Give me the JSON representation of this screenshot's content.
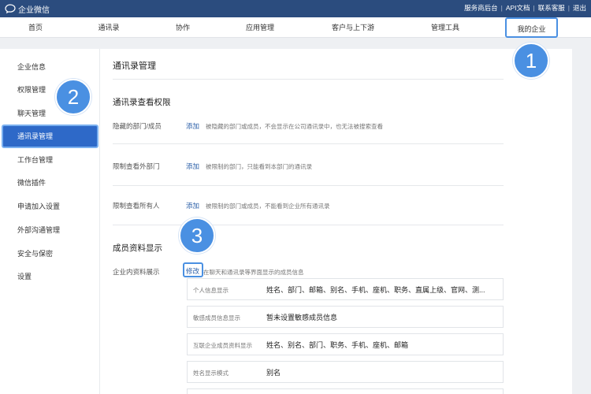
{
  "app": {
    "name": "企业微信"
  },
  "top_links": [
    "服务商后台",
    "API文档",
    "联系客服",
    "退出"
  ],
  "nav": {
    "items": [
      "首页",
      "通讯录",
      "协作",
      "应用管理",
      "客户与上下游",
      "管理工具"
    ],
    "active": "我的企业"
  },
  "sidebar": {
    "items": [
      "企业信息",
      "权限管理",
      "聊天管理",
      "工作台管理",
      "微信插件",
      "申请加入设置",
      "外部沟通管理",
      "安全与保密",
      "设置"
    ],
    "active": "通讯录管理"
  },
  "main": {
    "title": "通讯录管理",
    "section1_title": "通讯录查看权限",
    "rows": [
      {
        "label": "隐藏的部门/成员",
        "link": "添加",
        "desc": "被隐藏的部门或成员，不会显示在公司通讯录中，也无法被搜索查看"
      },
      {
        "label": "限制查看外部门",
        "link": "添加",
        "desc": "被限制的部门，只能看到本部门的通讯录"
      },
      {
        "label": "限制查看所有人",
        "link": "添加",
        "desc": "被限制的部门或成员，不能看到企业所有通讯录"
      }
    ],
    "section2_title": "成员资料显示",
    "profile_label": "企业内资料展示",
    "modify_link": "修改",
    "profile_desc": "在聊天和通讯录等界面显示的成员信息",
    "info_rows": [
      {
        "key": "个人信息显示",
        "value": "姓名、部门、邮箱、别名、手机、座机、职务、直属上级、官网、测..."
      },
      {
        "key": "敏感成员信息显示",
        "value": "暂未设置敏感成员信息"
      },
      {
        "key": "互联企业成员资料显示",
        "value": "姓名、别名、部门、职务、手机、座机、邮箱"
      },
      {
        "key": "姓名显示模式",
        "value": "别名"
      }
    ]
  },
  "callouts": [
    "1",
    "2",
    "3"
  ],
  "colors": {
    "topbar": "#2b4c7e",
    "accent": "#4a90e2",
    "sidebar_active": "#2e69c8",
    "link": "#2b5fa8"
  }
}
